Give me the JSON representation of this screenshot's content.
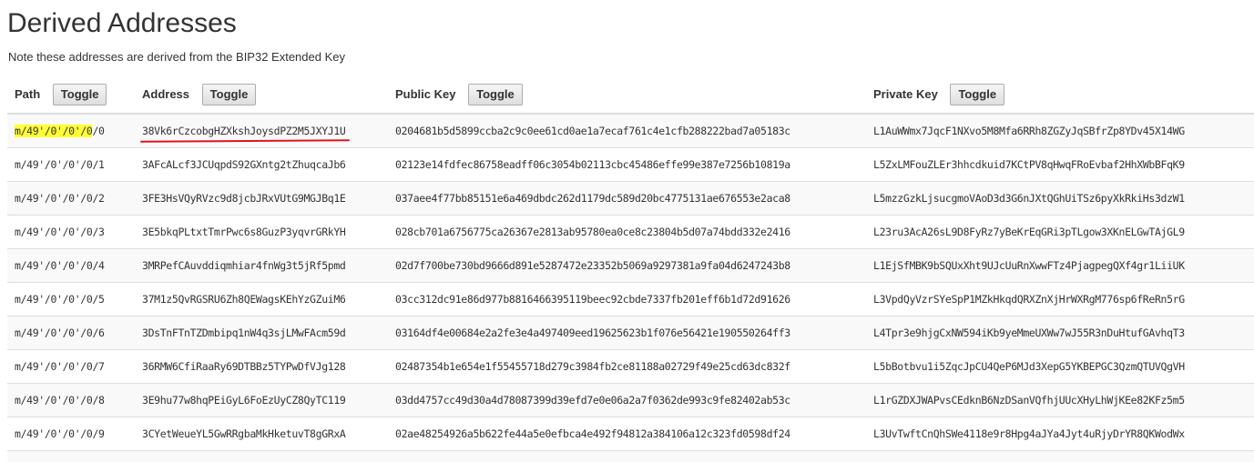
{
  "page": {
    "title": "Derived Addresses",
    "note": "Note these addresses are derived from the BIP32 Extended Key"
  },
  "table": {
    "columns": [
      {
        "label": "Path",
        "toggle_label": "Toggle"
      },
      {
        "label": "Address",
        "toggle_label": "Toggle"
      },
      {
        "label": "Public Key",
        "toggle_label": "Toggle"
      },
      {
        "label": "Private Key",
        "toggle_label": "Toggle"
      }
    ],
    "rows": [
      {
        "path_highlighted": "m/49'/0'/0'/0",
        "path_rest": "/0",
        "path": "m/49'/0'/0'/0/0",
        "address": "38Vk6rCzcobgHZXkshJoysdPZ2M5JXYJ1U",
        "public_key": "0204681b5d5899ccba2c9c0ee61cd0ae1a7ecaf761c4e1cfb288222bad7a05183c",
        "private_key": "L1AuWWmx7JqcF1NXvo5M8Mfa6RRh8ZGZyJqSBfrZp8YDv45X14WG"
      },
      {
        "path": "m/49'/0'/0'/0/1",
        "address": "3AFcALcf3JCUqpdS92GXntg2tZhuqcaJb6",
        "public_key": "02123e14fdfec86758eadff06c3054b02113cbc45486effe99e387e7256b10819a",
        "private_key": "L5ZxLMFouZLEr3hhcdkuid7KCtPV8qHwqFRoEvbaf2HhXWbBFqK9"
      },
      {
        "path": "m/49'/0'/0'/0/2",
        "address": "3FE3HsVQyRVzc9d8jcbJRxVUtG9MGJBq1E",
        "public_key": "037aee4f77bb85151e6a469dbdc262d1179dc589d20bc4775131ae676553e2aca8",
        "private_key": "L5mzzGzkLjsucgmoVAoD3d3G6nJXtQGhUiTSz6pyXkRkiHs3dzW1"
      },
      {
        "path": "m/49'/0'/0'/0/3",
        "address": "3E5bkqPLtxtTmrPwc6s8GuzP3yqvrGRkYH",
        "public_key": "028cb701a6756775ca26367e2813ab95780ea0ce8c23804b5d07a74bdd332e2416",
        "private_key": "L23ru3AcA26sL9D8FyRz7yBeKrEqGRi3pTLgow3XKnELGwTAjGL9"
      },
      {
        "path": "m/49'/0'/0'/0/4",
        "address": "3MRPefCAuvddiqmhiar4fnWg3t5jRf5pmd",
        "public_key": "02d7f700be730bd9666d891e5287472e23352b5069a9297381a9fa04d6247243b8",
        "private_key": "L1EjSfMBK9bSQUxXht9UJcUuRnXwwFTz4PjagpegQXf4gr1LiiUK"
      },
      {
        "path": "m/49'/0'/0'/0/5",
        "address": "37M1z5QvRGSRU6Zh8QEWagsKEhYzGZuiM6",
        "public_key": "03cc312dc91e86d977b8816466395119beec92cbde7337fb201eff6b1d72d91626",
        "private_key": "L3VpdQyVzrSYeSpP1MZkHkqdQRXZnXjHrWXRgM776sp6fReRn5rG"
      },
      {
        "path": "m/49'/0'/0'/0/6",
        "address": "3DsTnFTnTZDmbipq1nW4q3sjLMwFAcm59d",
        "public_key": "03164df4e00684e2a2fe3e4a497409eed19625623b1f076e56421e190550264ff3",
        "private_key": "L4Tpr3e9hjgCxNW594iKb9yeMmeUXWw7wJ55R3nDuHtufGAvhqT3"
      },
      {
        "path": "m/49'/0'/0'/0/7",
        "address": "36RMW6CfiRaaRy69DTBBz5TYPwDfVJg128",
        "public_key": "02487354b1e654e1f55455718d279c3984fb2ce81188a02729f49e25cd63dc832f",
        "private_key": "L5bBotbvu1i5ZqcJpCU4QeP6MJd3XepG5YKBEPGC3QzmQTUVQgVH"
      },
      {
        "path": "m/49'/0'/0'/0/8",
        "address": "3E9hu77w8hqPEiGyL6FoEzUyCZ8QyTC119",
        "public_key": "03dd4757cc49d30a4d78087399d39efd7e0e06a2a7f0362de993c9fe82402ab53c",
        "private_key": "L1rGZDXJWAPvsCEdknB6NzDSanVQfhjUUcXHyLhWjKEe82KFz5m5"
      },
      {
        "path": "m/49'/0'/0'/0/9",
        "address": "3CYetWeueYL5GwRRgbaMkHketuvT8gGRxA",
        "public_key": "02ae48254926a5b622fe44a5e0efbca4e492f94812a384106a12c323fd0598df24",
        "private_key": "L3UvTwftCnQhSWe4118e9r8Hpg4aJYa4Jyt4uRjyDrYR8QKWodWx"
      }
    ]
  },
  "annotations": {
    "highlight_color": "#ffff33",
    "underline_color": "#e0141e"
  }
}
